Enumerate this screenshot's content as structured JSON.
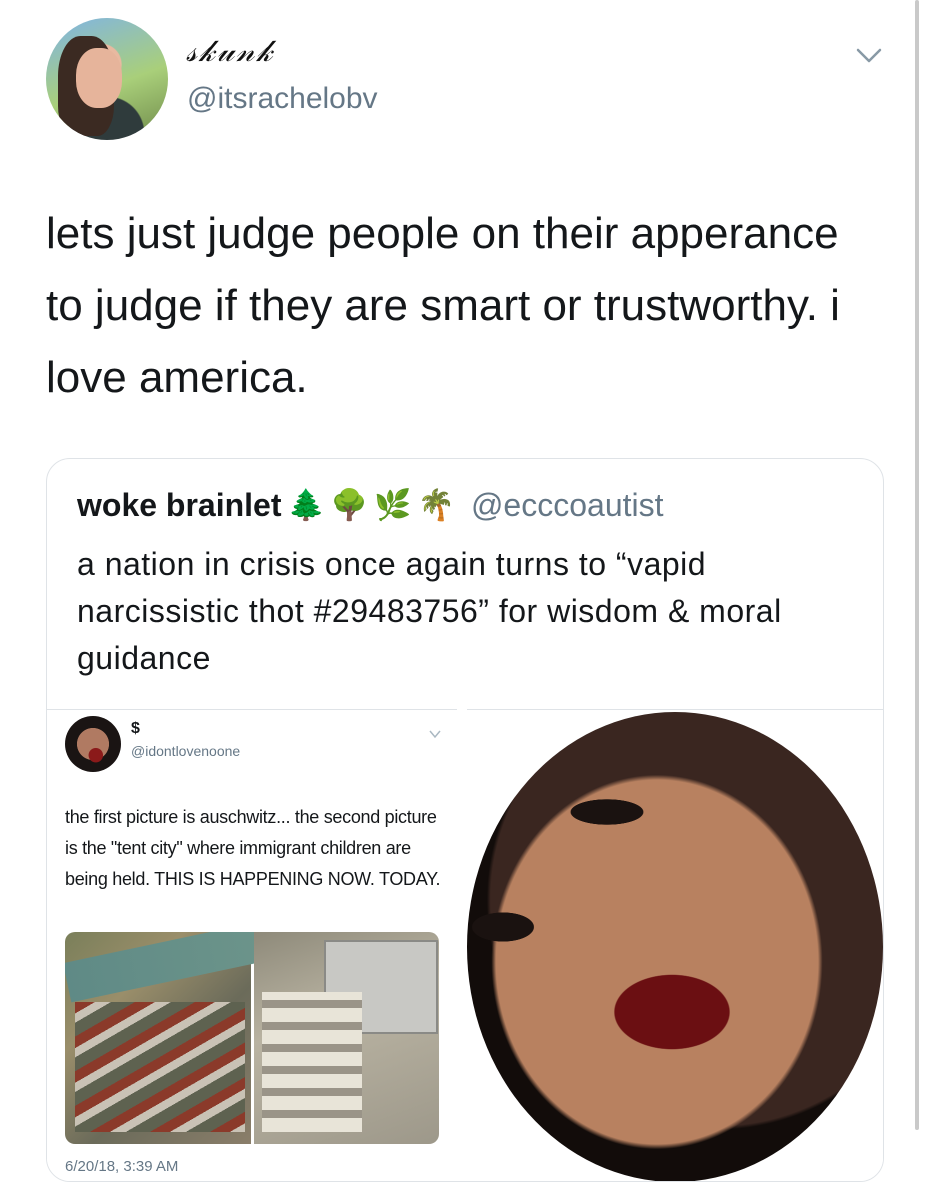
{
  "tweet": {
    "display_name": "𝓈𝓀𝓊𝓃𝓀",
    "handle": "@itsrachelobv",
    "text": "lets just judge people on their apperance to judge if they are smart or trustworthy. i love america."
  },
  "quote": {
    "name": "woke brainlet",
    "emojis": [
      "🌲",
      "🌳",
      "🌿",
      "🌴"
    ],
    "handle": "@ecccoautist",
    "text": "a nation in crisis once again turns to “vapid narcissistic thot #29483756” for wisdom & moral guidance",
    "embedded_tweet": {
      "name": "$",
      "handle": "@idontlovenoone",
      "text": "the first picture is auschwitz... the second picture is the \"tent city\" where immigrant children are being held. THIS IS HAPPENING NOW. TODAY.",
      "date": "6/20/18, 3:39 AM"
    }
  },
  "icons": {
    "menu": "chevron-down-icon",
    "embedded_menu": "chevron-down-icon"
  },
  "colors": {
    "text": "#14171a",
    "secondary": "#657786",
    "border": "#dfe3e7"
  }
}
